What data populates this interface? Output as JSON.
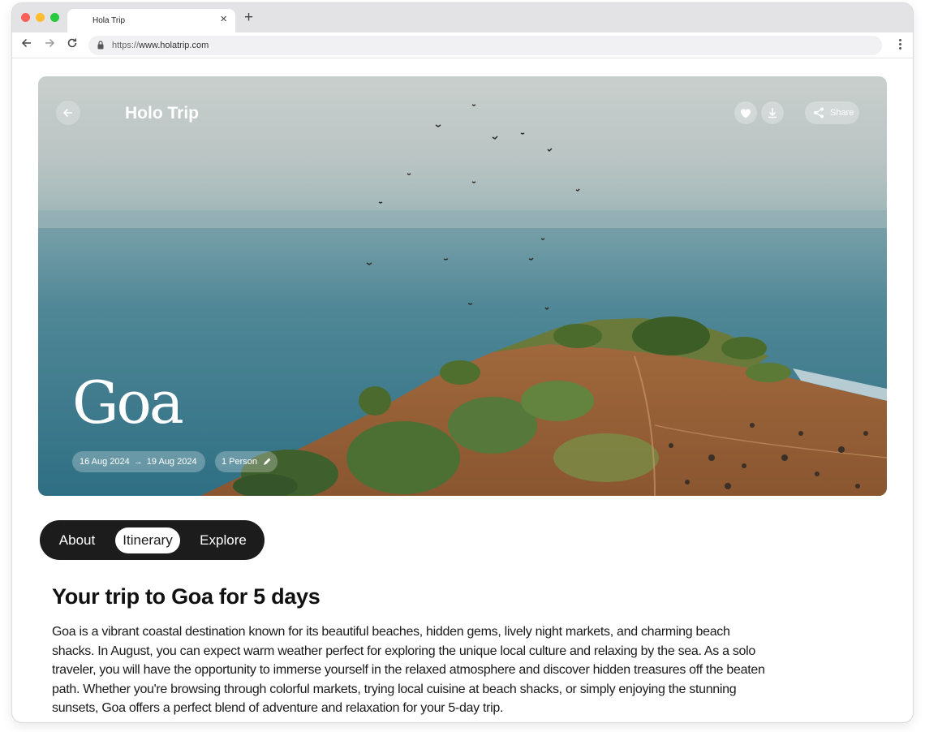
{
  "browser": {
    "tab_title": "Hola Trip",
    "tab_close": "×",
    "new_tab": "+",
    "url_protocol": "https://",
    "url_host": "www.holatrip.com"
  },
  "hero": {
    "brand": "Holo Trip",
    "share_label": "Share",
    "city": "Goa",
    "date_start": "16 Aug 2024",
    "date_arrow": "→",
    "date_end": "19 Aug 2024",
    "travelers": "1 Person"
  },
  "tabs": {
    "about": "About",
    "itinerary": "Itinerary",
    "explore": "Explore",
    "active": "Itinerary"
  },
  "content": {
    "title": "Your trip to Goa for 5 days",
    "description": "Goa is a vibrant coastal destination known for its beautiful beaches, hidden gems, lively night markets, and charming beach shacks. In August, you can expect warm weather perfect for exploring the unique local culture and relaxing by the sea. As a solo traveler, you will have the opportunity to immerse yourself in the relaxed atmosphere and discover hidden treasures off the beaten path. Whether you're browsing through colorful markets, trying local cuisine at beach shacks, or simply enjoying the stunning sunsets, Goa offers a perfect blend of adventure and relaxation for your 5-day trip."
  },
  "icons": {
    "back": "arrow-left-icon",
    "favorite": "heart-icon",
    "download": "download-icon",
    "share": "share-icon",
    "edit": "pencil-icon"
  }
}
